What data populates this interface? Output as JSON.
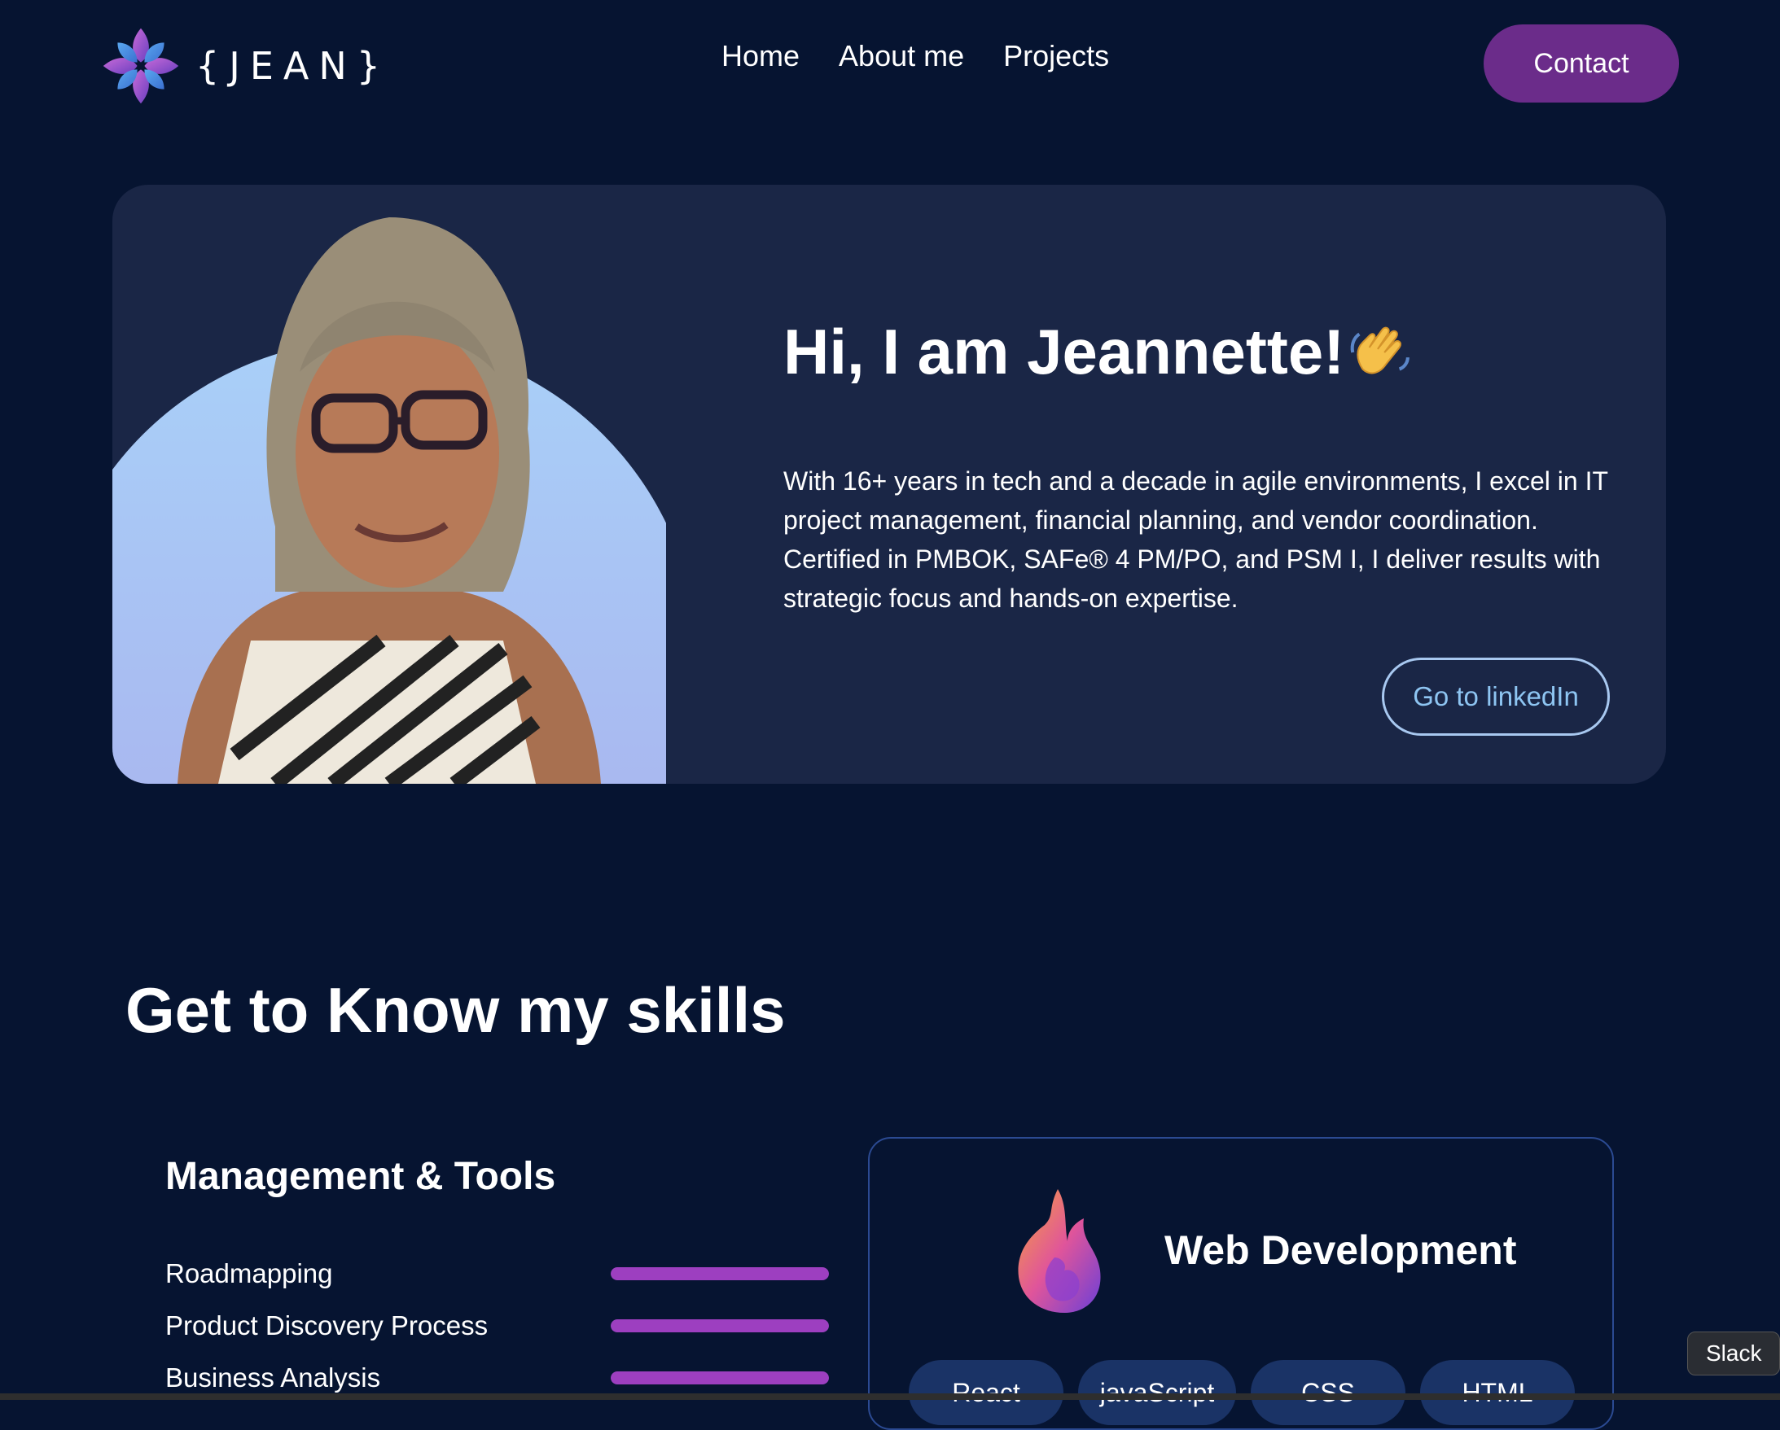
{
  "brand": {
    "name": "{JEAN}"
  },
  "nav": {
    "items": [
      "Home",
      "About me",
      "Projects"
    ],
    "contact_label": "Contact"
  },
  "hero": {
    "title": "Hi, I am Jeannette!",
    "bio": "With 16+ years in tech and a decade in agile environments, I excel in IT project management, financial planning, and vendor coordination. Certified in PMBOK, SAFe® 4 PM/PO, and PSM I, I deliver results with strategic focus and hands-on expertise.",
    "linkedin_label": "Go to linkedIn"
  },
  "skills": {
    "title": "Get to Know my skills",
    "management": {
      "title": "Management & Tools",
      "items": [
        {
          "label": "Roadmapping",
          "level": 1.0
        },
        {
          "label": "Product Discovery Process",
          "level": 1.0
        },
        {
          "label": "Business Analysis",
          "level": 1.0
        }
      ]
    },
    "web": {
      "title": "Web Development",
      "chips": [
        "React",
        "javaScript",
        "CSS",
        "HTML"
      ]
    }
  },
  "tooltip": {
    "label": "Slack"
  },
  "colors": {
    "background": "#061431",
    "card": "#1a2646",
    "accent": "#6b2c8a",
    "bar": "#9d3fc0",
    "link": "#8ec5f2"
  }
}
